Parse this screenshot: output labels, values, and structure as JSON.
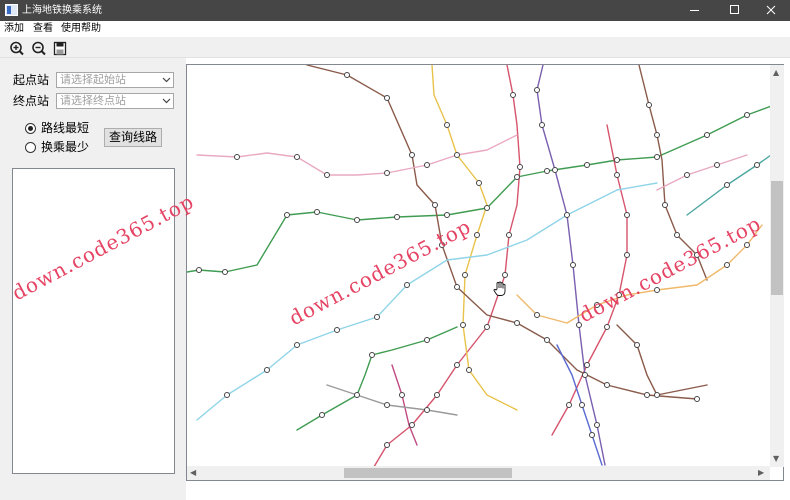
{
  "window": {
    "title": "上海地铁换乘系统"
  },
  "menu": {
    "items": [
      "添加",
      "查看",
      "使用帮助"
    ]
  },
  "toolbar": {
    "buttons": [
      "zoom-in-icon",
      "zoom-out-icon",
      "save-icon"
    ]
  },
  "form": {
    "start_label": "起点站",
    "start_placeholder": "请选择起始站",
    "end_label": "终点站",
    "end_placeholder": "请选择终点站",
    "option_shortest": "路线最短",
    "option_fewest": "换乘最少",
    "selected_option": "路线最短",
    "query_button": "查询线路"
  },
  "watermark": {
    "text": "down.code365.top"
  },
  "colors": {
    "titlebar": "#464646",
    "panel": "#f0f0f0",
    "line_red": "#d6546c",
    "line_green": "#3f9c52",
    "line_yellow": "#e8c24a",
    "line_purple": "#7a5fb0",
    "line_pink": "#e9a9c2",
    "line_lightblue": "#8fd4e8",
    "line_brown": "#8a5a4a",
    "line_orange": "#f0b86a",
    "line_blue": "#5a6ad0",
    "watermark": "#e43a5c"
  }
}
